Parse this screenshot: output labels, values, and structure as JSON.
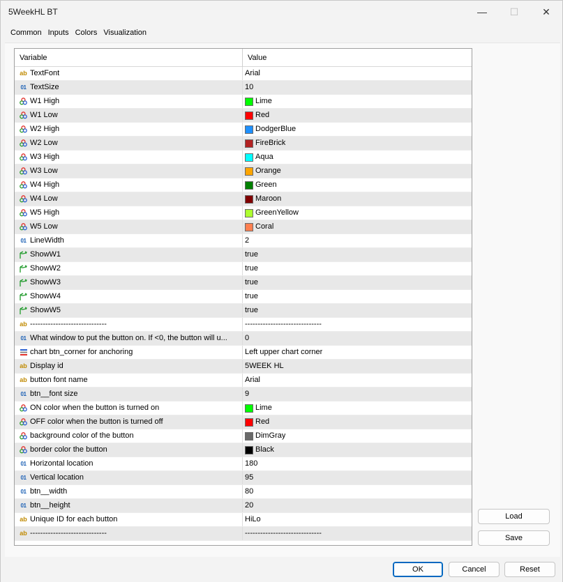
{
  "window": {
    "title": "5WeekHL BT",
    "minimize": "—",
    "maximize": "☐",
    "close": "✕"
  },
  "tabs": [
    "Common",
    "Inputs",
    "Colors",
    "Visualization"
  ],
  "active_tab": "Inputs",
  "grid": {
    "headers": {
      "variable": "Variable",
      "value": "Value"
    },
    "rows": [
      {
        "type": "string",
        "name": "TextFont",
        "value": "Arial"
      },
      {
        "type": "int",
        "name": "TextSize",
        "value": "10"
      },
      {
        "type": "color",
        "name": "W1 High",
        "value": "Lime",
        "swatch": "#00ff00"
      },
      {
        "type": "color",
        "name": "W1 Low",
        "value": "Red",
        "swatch": "#ff0000"
      },
      {
        "type": "color",
        "name": "W2 High",
        "value": "DodgerBlue",
        "swatch": "#1e90ff"
      },
      {
        "type": "color",
        "name": "W2 Low",
        "value": "FireBrick",
        "swatch": "#b22222"
      },
      {
        "type": "color",
        "name": "W3 High",
        "value": "Aqua",
        "swatch": "#00ffff"
      },
      {
        "type": "color",
        "name": "W3 Low",
        "value": "Orange",
        "swatch": "#ffa500"
      },
      {
        "type": "color",
        "name": "W4 High",
        "value": "Green",
        "swatch": "#008000"
      },
      {
        "type": "color",
        "name": "W4 Low",
        "value": "Maroon",
        "swatch": "#800000"
      },
      {
        "type": "color",
        "name": "W5 High",
        "value": "GreenYellow",
        "swatch": "#adff2f"
      },
      {
        "type": "color",
        "name": "W5 Low",
        "value": "Coral",
        "swatch": "#ff7f50"
      },
      {
        "type": "int",
        "name": "LineWidth",
        "value": "2"
      },
      {
        "type": "bool",
        "name": "ShowW1",
        "value": "true"
      },
      {
        "type": "bool",
        "name": "ShowW2",
        "value": "true"
      },
      {
        "type": "bool",
        "name": "ShowW3",
        "value": "true"
      },
      {
        "type": "bool",
        "name": "ShowW4",
        "value": "true"
      },
      {
        "type": "bool",
        "name": "ShowW5",
        "value": "true"
      },
      {
        "type": "string",
        "name": "------------------------------",
        "value": "------------------------------"
      },
      {
        "type": "int",
        "name": "What window to put the button on.  If <0, the button will u...",
        "value": "0"
      },
      {
        "type": "enum",
        "name": "chart btn_corner for anchoring",
        "value": "Left upper chart corner"
      },
      {
        "type": "string",
        "name": "Display id",
        "value": "5WEEK HL"
      },
      {
        "type": "string",
        "name": "button font name",
        "value": "Arial"
      },
      {
        "type": "int",
        "name": "btn__font size",
        "value": "9"
      },
      {
        "type": "color",
        "name": "ON color when the button is turned on",
        "value": "Lime",
        "swatch": "#00ff00"
      },
      {
        "type": "color",
        "name": "OFF color when the button is turned off",
        "value": "Red",
        "swatch": "#ff0000"
      },
      {
        "type": "color",
        "name": "background color of the button",
        "value": "DimGray",
        "swatch": "#696969"
      },
      {
        "type": "color",
        "name": "border color the button",
        "value": "Black",
        "swatch": "#000000"
      },
      {
        "type": "int",
        "name": "Horizontal location",
        "value": "180"
      },
      {
        "type": "int",
        "name": "Vertical location",
        "value": "95"
      },
      {
        "type": "int",
        "name": "btn__width",
        "value": "80"
      },
      {
        "type": "int",
        "name": "btn__height",
        "value": "20"
      },
      {
        "type": "string",
        "name": "Unique ID for each button",
        "value": "HiLo"
      },
      {
        "type": "string",
        "name": "------------------------------",
        "value": "------------------------------"
      }
    ]
  },
  "icons": {
    "string": "ab",
    "int": "01"
  },
  "buttons": {
    "load": "Load",
    "save": "Save",
    "ok": "OK",
    "cancel": "Cancel",
    "reset": "Reset"
  },
  "colors": {
    "accent": "#0067c0"
  }
}
